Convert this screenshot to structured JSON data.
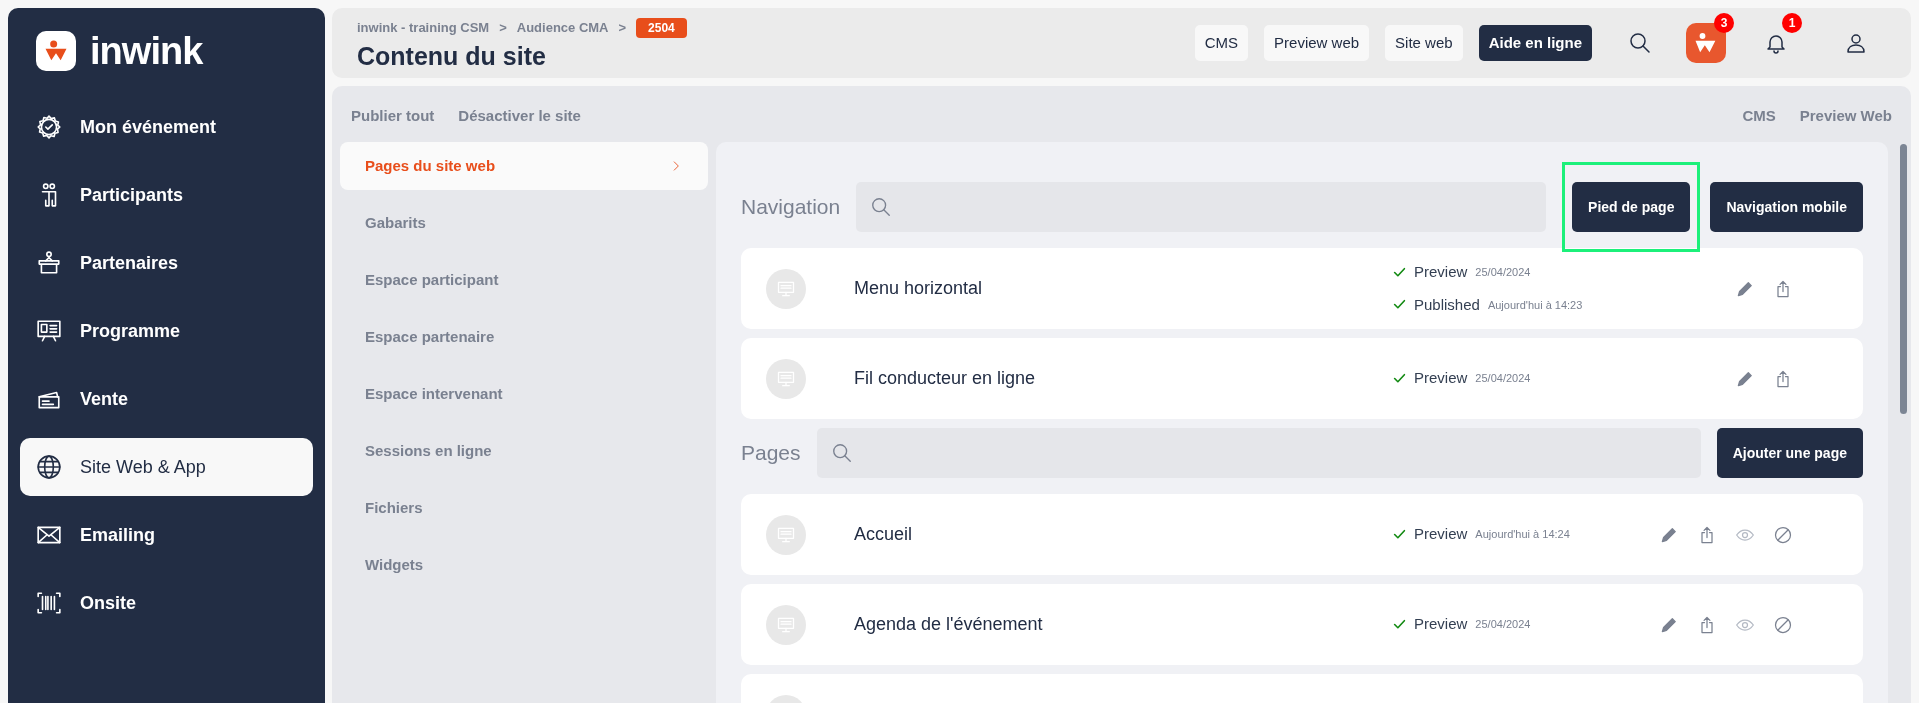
{
  "sidebar": {
    "logo": "inwink",
    "items": [
      {
        "label": "Mon événement",
        "selected": false
      },
      {
        "label": "Participants",
        "selected": false
      },
      {
        "label": "Partenaires",
        "selected": false
      },
      {
        "label": "Programme",
        "selected": false
      },
      {
        "label": "Vente",
        "selected": false
      },
      {
        "label": "Site Web & App",
        "selected": true
      },
      {
        "label": "Emailing",
        "selected": false
      },
      {
        "label": "Onsite",
        "selected": false
      }
    ]
  },
  "header": {
    "breadcrumb": [
      "inwink - training CSM",
      "Audience CMA"
    ],
    "separator": ">",
    "badge": "2504",
    "title": "Contenu du site",
    "buttons": [
      {
        "label": "CMS",
        "primary": false
      },
      {
        "label": "Preview web",
        "primary": false
      },
      {
        "label": "Site web",
        "primary": false
      },
      {
        "label": "Aide en ligne",
        "primary": true
      }
    ],
    "app_badge": "3",
    "notification_badge": "1"
  },
  "toolbar": {
    "left": [
      "Publier tout",
      "Désactiver le site"
    ],
    "right": [
      "CMS",
      "Preview Web"
    ]
  },
  "submenu": [
    {
      "label": "Pages du site web",
      "selected": true
    },
    {
      "label": "Gabarits",
      "selected": false
    },
    {
      "label": "Espace participant",
      "selected": false
    },
    {
      "label": "Espace partenaire",
      "selected": false
    },
    {
      "label": "Espace intervenant",
      "selected": false
    },
    {
      "label": "Sessions en ligne",
      "selected": false
    },
    {
      "label": "Fichiers",
      "selected": false
    },
    {
      "label": "Widgets",
      "selected": false
    }
  ],
  "navigation": {
    "title": "Navigation",
    "buttons": [
      {
        "label": "Pied de page",
        "highlighted": true
      },
      {
        "label": "Navigation mobile",
        "highlighted": false
      }
    ],
    "rows": [
      {
        "kind": "navigation",
        "name": "Menu horizontal",
        "statuses": [
          {
            "label": "Preview",
            "date": "25/04/2024"
          },
          {
            "label": "Published",
            "date": "Aujourd'hui à 14:23"
          }
        ]
      },
      {
        "kind": "navigation",
        "name": "Fil conducteur en ligne",
        "statuses": [
          {
            "label": "Preview",
            "date": "25/04/2024"
          }
        ]
      }
    ]
  },
  "pages": {
    "title": "Pages",
    "buttons": [
      {
        "label": "Ajouter une page",
        "highlighted": false
      }
    ],
    "rows": [
      {
        "kind": "page",
        "name": "Accueil",
        "statuses": [
          {
            "label": "Preview",
            "date": "Aujourd'hui à 14:24"
          }
        ]
      },
      {
        "kind": "page",
        "name": "Agenda de l'événement",
        "statuses": [
          {
            "label": "Preview",
            "date": "25/04/2024"
          }
        ]
      },
      {
        "kind": "page"
      }
    ]
  }
}
